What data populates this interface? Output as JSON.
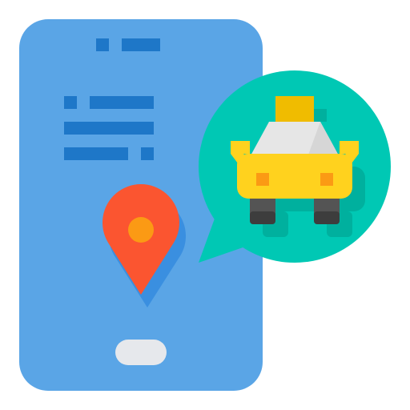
{
  "icon": {
    "subject": "taxi-booking-app-icon",
    "parts": [
      "phone-icon",
      "map-pin-icon",
      "speech-bubble-icon",
      "taxi-icon"
    ]
  },
  "colors": {
    "background": "#ffffff",
    "phone_body": "#5aa5e6",
    "phone_lines": "#1e77c8",
    "home_button": "#e6e8ec",
    "pin": "#fb5530",
    "pin_center": "#fb9a14",
    "pin_shadow": "#3a8fe0",
    "bubble": "#00c8b4",
    "bubble_shadow": "#00b09e",
    "car_body": "#ffd21e",
    "car_roof_sign": "#f0bc00",
    "car_windshield": "#e6e6e6",
    "car_lights": "#fb9a14",
    "car_wheels": "#545454"
  }
}
